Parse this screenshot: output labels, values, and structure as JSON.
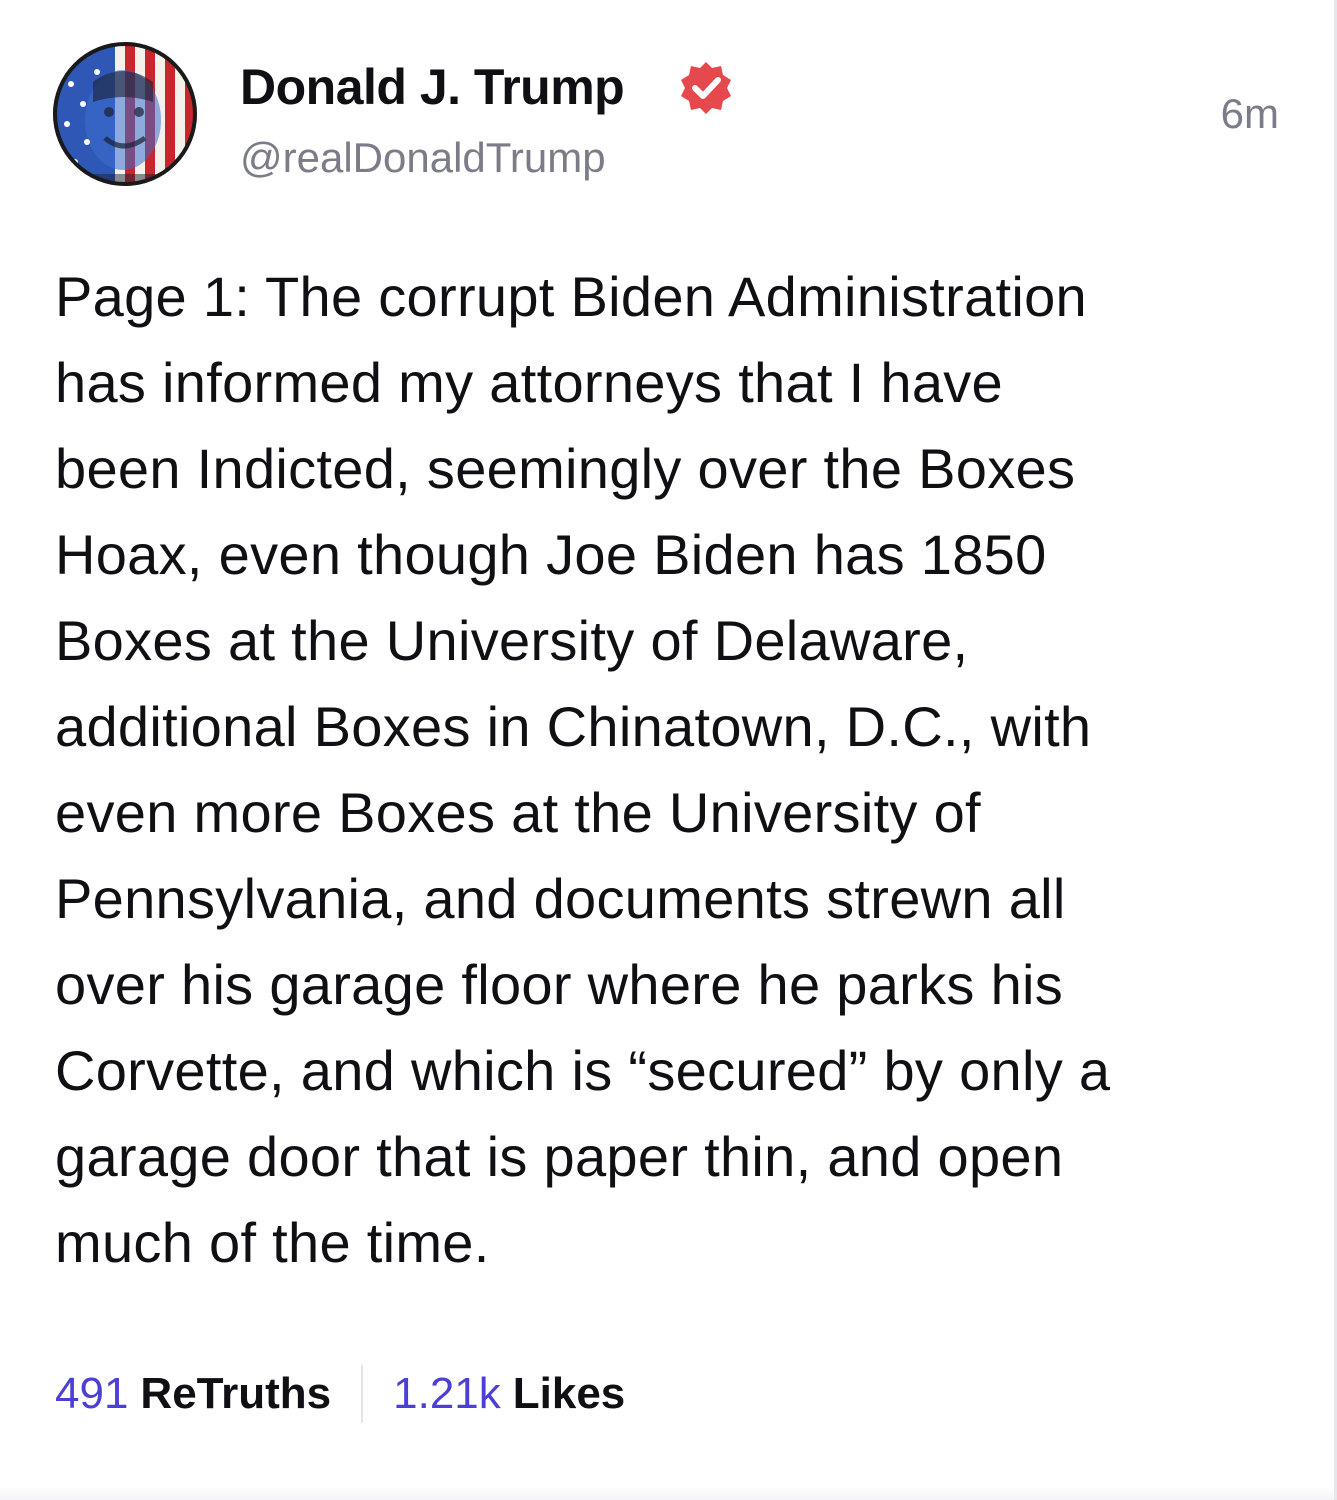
{
  "author": {
    "display_name": "Donald J. Trump",
    "handle": "@realDonaldTrump",
    "verified": true,
    "avatar_icon": "flag-portrait-avatar",
    "verified_icon": "verified-badge-icon"
  },
  "post": {
    "timestamp": "6m",
    "lines": [
      "Page 1: The corrupt Biden Administration",
      "has informed my attorneys that I have",
      "been Indicted, seemingly over the Boxes",
      "Hoax, even though Joe Biden has 1850",
      "Boxes at the University of Delaware,",
      "additional Boxes in Chinatown, D.C., with",
      "even more Boxes at the University of",
      "Pennsylvania, and documents strewn all",
      "over his garage floor where he parks his",
      "Corvette, and which is “secured” by only a",
      "garage door that is paper thin, and open",
      "much of the time."
    ]
  },
  "stats": {
    "retruths_count": "491",
    "retruths_label": "ReTruths",
    "likes_count": "1.21k",
    "likes_label": "Likes"
  },
  "colors": {
    "accent": "#4c3fd6",
    "verified": "#e5484d",
    "muted_text": "#7c7c88",
    "text": "#0f0f14"
  }
}
